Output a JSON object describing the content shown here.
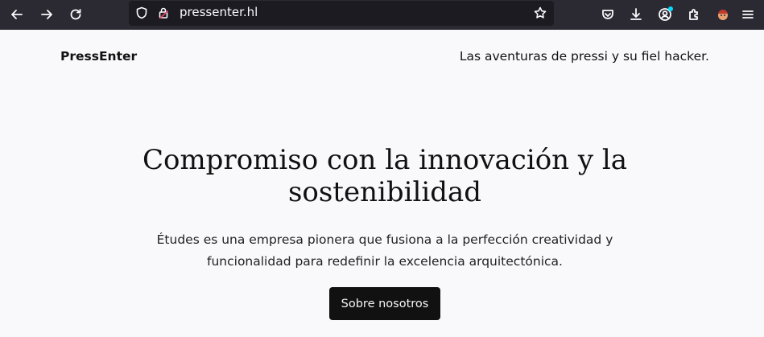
{
  "browser": {
    "url": "pressenter.hl",
    "icons": [
      "back-arrow-icon",
      "forward-arrow-icon",
      "reload-icon",
      "shield-icon",
      "lock-icon",
      "bookmark-star-icon",
      "pocket-icon",
      "download-icon",
      "account-icon",
      "extensions-icon",
      "addon-icon",
      "menu-icon"
    ]
  },
  "site": {
    "brand": "PressEnter",
    "tagline": "Las aventuras de pressi y su fiel hacker.",
    "hero": {
      "title": "Compromiso con la innovación y la sostenibilidad",
      "subtitle": "Études es una empresa pionera que fusiona a la perfección creatividad y funcionalidad para redefinir la excelencia arquitectónica.",
      "cta_label": "Sobre nosotros"
    }
  },
  "colors": {
    "toolbar_bg": "#2b2a33",
    "urlbar_bg": "#1c1b22",
    "page_bg": "#f9f9fb",
    "button_bg": "#111111",
    "lock_accent": "#e0486a"
  }
}
